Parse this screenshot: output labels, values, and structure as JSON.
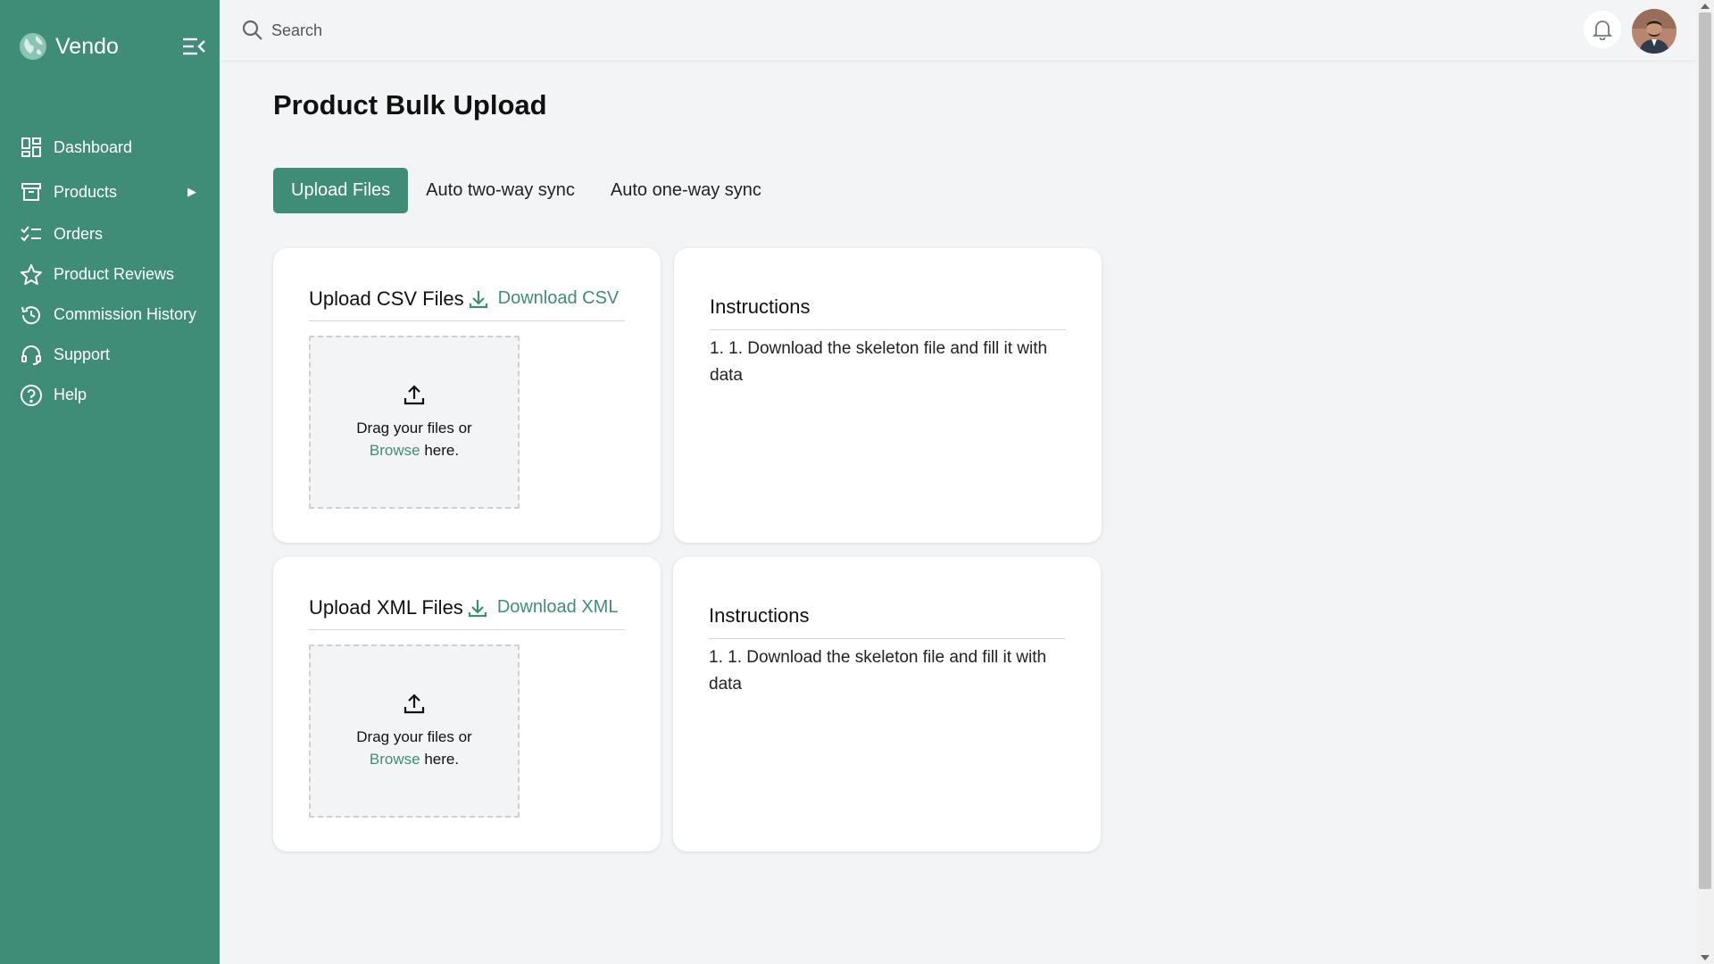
{
  "app": {
    "name": "Vendo"
  },
  "sidebar": {
    "items": [
      {
        "label": "Dashboard",
        "icon": "dashboard-icon"
      },
      {
        "label": "Products",
        "icon": "box-icon",
        "arrow": "▶"
      },
      {
        "label": "Orders",
        "icon": "checklist-icon"
      },
      {
        "label": "Product Reviews",
        "icon": "star-icon"
      },
      {
        "label": "Commission History",
        "icon": "history-icon"
      },
      {
        "label": "Support",
        "icon": "headset-icon"
      },
      {
        "label": "Help",
        "icon": "help-icon"
      }
    ]
  },
  "topbar": {
    "search_placeholder": "Search"
  },
  "page": {
    "title": "Product Bulk Upload"
  },
  "tabs": [
    {
      "label": "Upload Files",
      "active": true
    },
    {
      "label": "Auto two-way sync",
      "active": false
    },
    {
      "label": "Auto one-way sync",
      "active": false
    }
  ],
  "csv": {
    "title": "Upload CSV Files",
    "download_label": "Download CSV",
    "drop_text": "Drag your files or",
    "browse": "Browse",
    "here": " here."
  },
  "xml": {
    "title": "Upload XML Files",
    "download_label": "Download XML",
    "drop_text": "Drag your files or",
    "browse": "Browse",
    "here": " here."
  },
  "instructions": [
    {
      "title": "Instructions",
      "text": "1. 1. Download the skeleton file and fill it with data"
    },
    {
      "title": "Instructions",
      "text": "1. 1. Download the skeleton file and fill it with data"
    }
  ],
  "colors": {
    "primary": "#3f8d77",
    "background": "#f3f4f6"
  }
}
